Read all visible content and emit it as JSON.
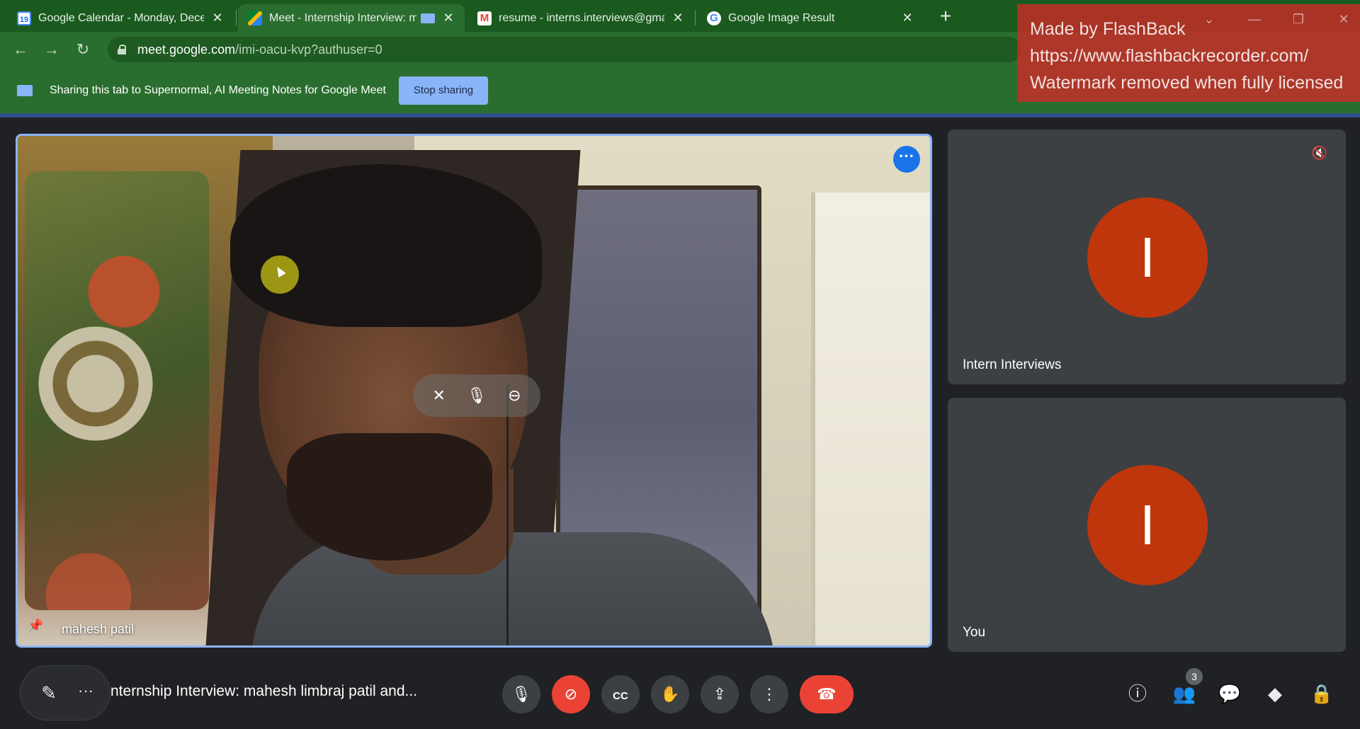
{
  "browser": {
    "tabs": [
      {
        "title": "Google Calendar - Monday, Decemb",
        "favicon": "calendar-icon",
        "active": false
      },
      {
        "title": "Meet - Internship Interview: ma",
        "favicon": "meet-icon",
        "active": true
      },
      {
        "title": "resume - interns.interviews@gmail.c",
        "favicon": "gmail-icon",
        "active": false
      },
      {
        "title": "Google Image Result",
        "favicon": "google-icon",
        "active": false
      }
    ],
    "calendar_favicon_text": "19",
    "new_tab_label": "+",
    "url_host": "meet.google.com",
    "url_path": "/imi-oacu-kvp?authuser=0"
  },
  "sharing_banner": {
    "text": "Sharing this tab to Supernormal, AI Meeting Notes for Google Meet",
    "stop_label": "Stop sharing"
  },
  "watermark": {
    "line1": "Made by FlashBack",
    "line2": "https://www.flashbackrecorder.com/",
    "line3": "Watermark removed when fully licensed"
  },
  "main_tile": {
    "participant": "mahesh patil",
    "more_icon": "more-horiz-icon"
  },
  "side_tiles": [
    {
      "name": "Intern Interviews",
      "initial": "I",
      "avatar_color": "#bf360c",
      "muted": true
    },
    {
      "name": "You",
      "initial": "I",
      "avatar_color": "#bf360c",
      "muted": false
    }
  ],
  "bottom_bar": {
    "meeting_title": "nternship Interview: mahesh limbraj patil and...",
    "people_count": "3"
  },
  "colors": {
    "browser_frame": "#2a6e2f",
    "meet_bg": "#202124",
    "tile_bg": "#3c4043",
    "accent_blue": "#8ab4f8",
    "hangup_red": "#ea4335"
  }
}
